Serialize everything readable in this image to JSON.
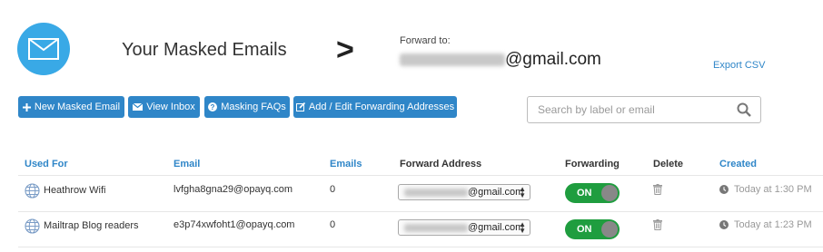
{
  "header": {
    "title": "Your Masked Emails",
    "forward_label": "Forward to:",
    "forward_suffix": "@gmail.com",
    "export_label": "Export CSV"
  },
  "toolbar": {
    "new_label": "New Masked Email",
    "inbox_label": "View Inbox",
    "faqs_label": "Masking FAQs",
    "edit_label": "Add / Edit Forwarding Addresses"
  },
  "search": {
    "placeholder": "Search by label or email"
  },
  "table": {
    "headers": {
      "used_for": "Used For",
      "email": "Email",
      "emails": "Emails",
      "forward_address": "Forward Address",
      "forwarding": "Forwarding",
      "delete": "Delete",
      "created": "Created"
    },
    "rows": [
      {
        "used_for": "Heathrow Wifi",
        "email": "lvfgha8gna29@opayq.com",
        "emails": "0",
        "forward_suffix": "@gmail.com",
        "forwarding": "ON",
        "created": "Today at 1:30 PM"
      },
      {
        "used_for": "Mailtrap Blog readers",
        "email": "e3p74xwfoht1@opayq.com",
        "emails": "0",
        "forward_suffix": "@gmail.com",
        "forwarding": "ON",
        "created": "Today at 1:23 PM"
      }
    ]
  },
  "colors": {
    "accent": "#2f86c8",
    "logo": "#39a9e6",
    "toggle_on": "#1f9d3f"
  },
  "icons": [
    "envelope-icon",
    "plus-icon",
    "inbox-icon",
    "question-icon",
    "edit-icon",
    "search-icon",
    "globe-icon",
    "trash-icon",
    "clock-icon"
  ]
}
